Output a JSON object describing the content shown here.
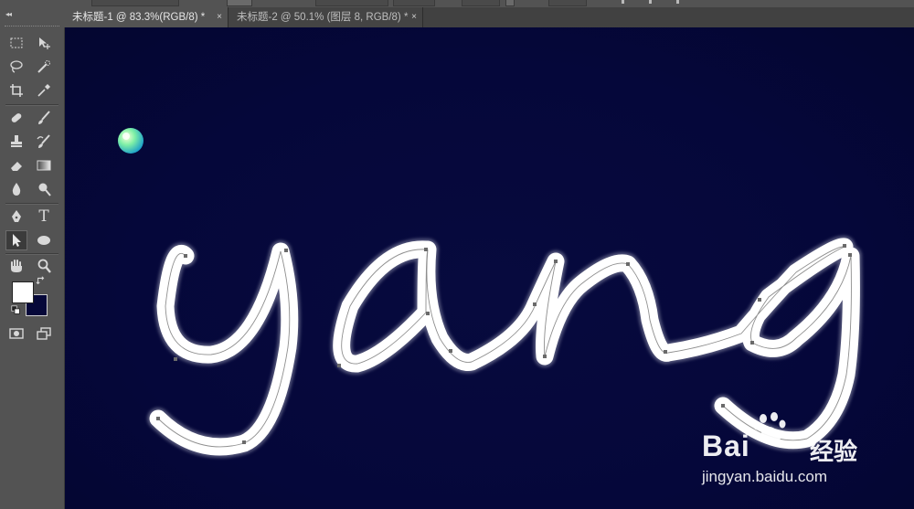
{
  "tabs": [
    {
      "label": "未标题-1 @ 83.3%(RGB/8) *",
      "close": "×"
    },
    {
      "label": "未标题-2 @ 50.1% (图层 8, RGB/8) *",
      "close": "×"
    }
  ],
  "toolbox": {
    "collapse": "◂◂",
    "type_tool_label": "T",
    "foreground_color": "#ffffff",
    "background_color": "#060839"
  },
  "canvas": {
    "background": "#050739",
    "text": "yang",
    "stroke_color": "#ffffff",
    "path_color": "#9a9a9a"
  },
  "watermark": {
    "brand_prefix": "Bai",
    "brand_suffix": "经验",
    "url": "jingyan.baidu.com"
  }
}
